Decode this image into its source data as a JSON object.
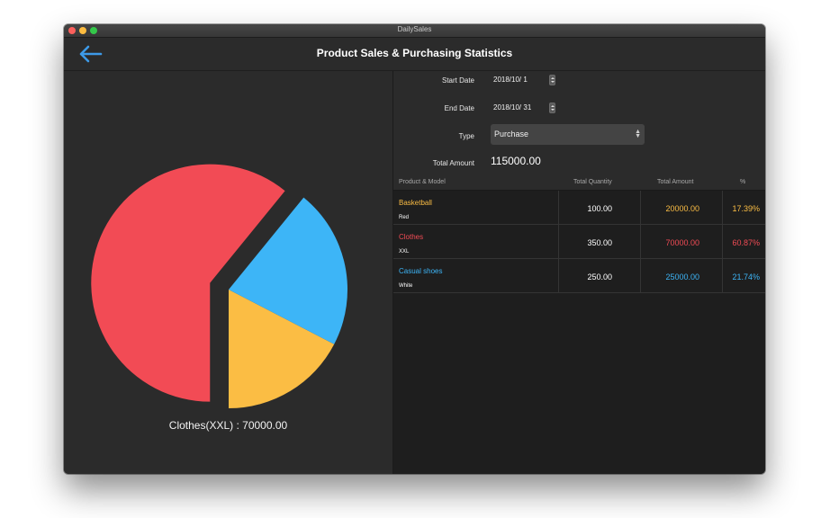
{
  "window": {
    "title": "DailySales"
  },
  "nav": {
    "title": "Product Sales & Purchasing Statistics",
    "back_icon": "arrow-left-icon"
  },
  "form": {
    "start_date_label": "Start Date",
    "start_date_value": "2018/10/  1",
    "end_date_label": "End Date",
    "end_date_value": "2018/10/ 31",
    "type_label": "Type",
    "type_value": "Purchase",
    "total_amount_label": "Total Amount",
    "total_amount_value": "115000.00"
  },
  "table": {
    "headers": [
      "Product & Model",
      "Total Quantity",
      "Total Amount",
      "%"
    ],
    "rows": [
      {
        "name": "Basketball",
        "model": "Red",
        "quantity": "100.00",
        "amount": "20000.00",
        "percent": "17.39%",
        "color": "#fbbd44"
      },
      {
        "name": "Clothes",
        "model": "XXL",
        "quantity": "350.00",
        "amount": "70000.00",
        "percent": "60.87%",
        "color": "#f24b55"
      },
      {
        "name": "Casual shoes",
        "model": "White",
        "quantity": "250.00",
        "amount": "25000.00",
        "percent": "21.74%",
        "color": "#3db5f7"
      }
    ]
  },
  "chart_data": {
    "type": "pie",
    "categories": [
      "Basketball",
      "Clothes",
      "Casual shoes"
    ],
    "values": [
      17.39,
      60.87,
      21.74
    ],
    "colors": [
      "#fbbd44",
      "#f24b55",
      "#3db5f7"
    ],
    "highlighted": "Clothes",
    "caption": "Clothes(XXL) : 70000.00"
  },
  "colors": {
    "accent": "#3d9ae8",
    "background": "#2b2b2b",
    "table_bg": "#1e1e1e"
  }
}
